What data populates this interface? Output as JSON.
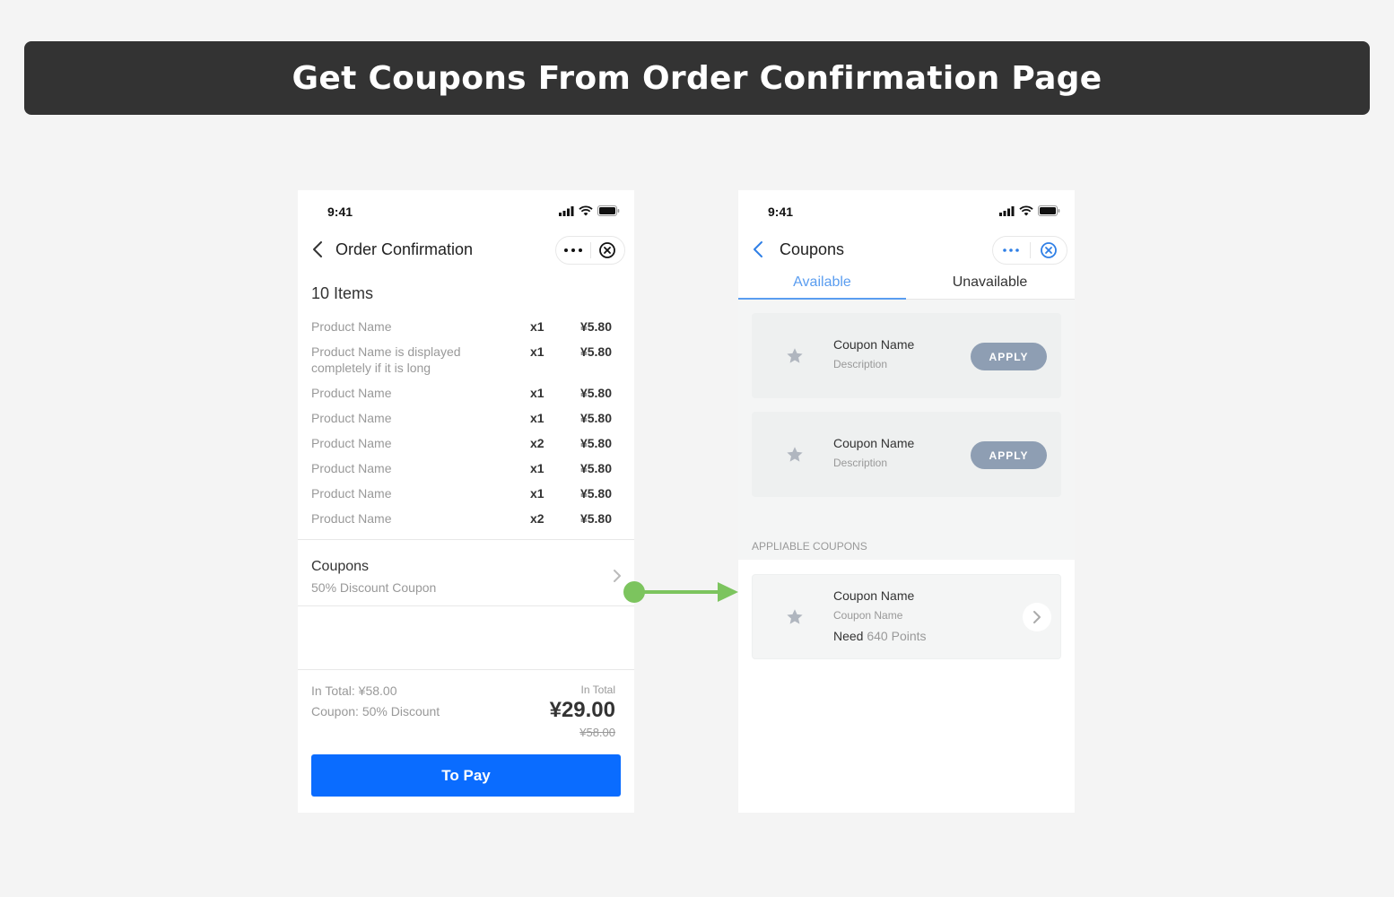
{
  "banner": {
    "title": "Get Coupons From Order Confirmation Page"
  },
  "order_screen": {
    "status_time": "9:41",
    "nav_title": "Order Confirmation",
    "items_count": "10 Items",
    "products": [
      {
        "name": "Product Name",
        "qty": "x1",
        "price": "¥5.80"
      },
      {
        "name": "Product Name is displayed completely if it is long",
        "qty": "x1",
        "price": "¥5.80"
      },
      {
        "name": "Product Name",
        "qty": "x1",
        "price": "¥5.80"
      },
      {
        "name": "Product Name",
        "qty": "x1",
        "price": "¥5.80"
      },
      {
        "name": "Product Name",
        "qty": "x2",
        "price": "¥5.80"
      },
      {
        "name": "Product Name",
        "qty": "x1",
        "price": "¥5.80"
      },
      {
        "name": "Product Name",
        "qty": "x1",
        "price": "¥5.80"
      },
      {
        "name": "Product Name",
        "qty": "x2",
        "price": "¥5.80"
      }
    ],
    "coupons_label": "Coupons",
    "coupons_value": "50% Discount Coupon",
    "in_total_line": "In Total:  ¥58.00",
    "coupon_line": "Coupon: 50% Discount",
    "total_caption": "In Total",
    "total_amount": "¥29.00",
    "total_original": "¥58.00",
    "pay_button": "To Pay"
  },
  "coupons_screen": {
    "status_time": "9:41",
    "nav_title": "Coupons",
    "tabs": [
      "Available",
      "Unavailable"
    ],
    "available": [
      {
        "name": "Coupon Name",
        "description": "Description",
        "action": "APPLY"
      },
      {
        "name": "Coupon Name",
        "description": "Description",
        "action": "APPLY"
      }
    ],
    "section_title": "APPLIABLE COUPONS",
    "appliable": [
      {
        "name": "Coupon Name",
        "subtitle": "Coupon Name",
        "need_label": "Need",
        "points": "640 Points"
      }
    ]
  },
  "colors": {
    "primary": "#0a6cff",
    "tab_active": "#5a9df0",
    "apply": "#8e9eb3",
    "flow_arrow": "#7cc45e",
    "banner": "#333333"
  }
}
